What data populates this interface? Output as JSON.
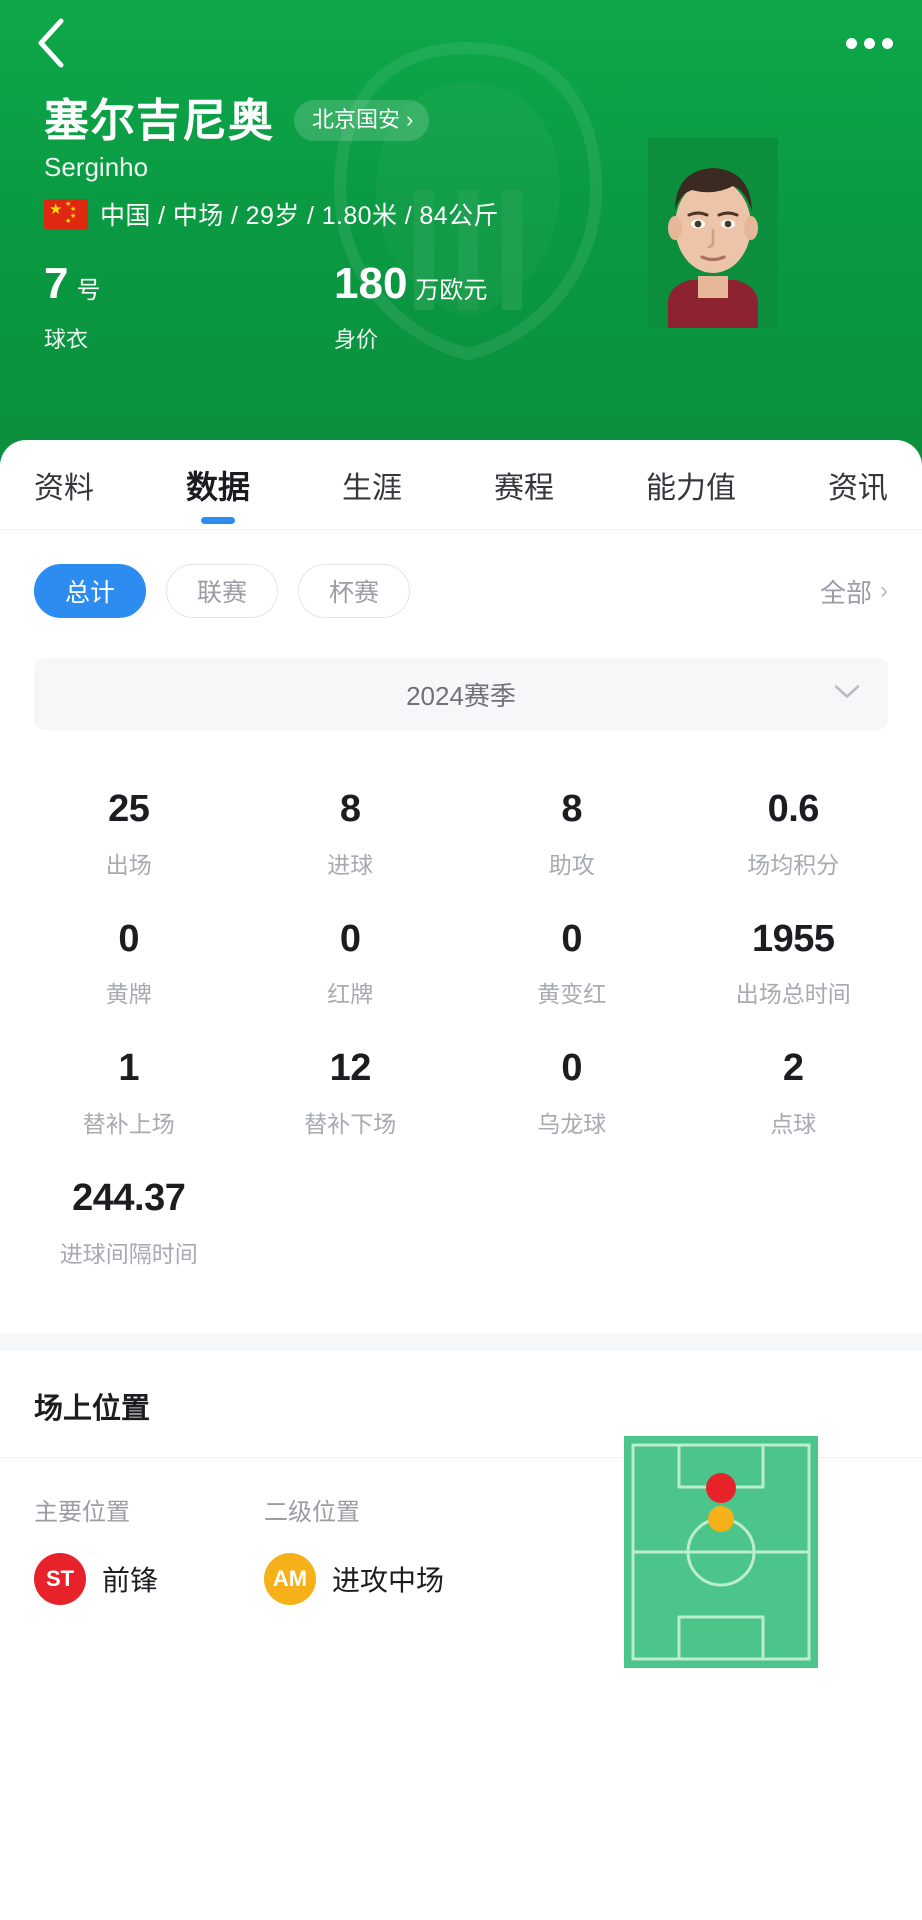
{
  "header": {
    "back_icon": "chevron-left-icon",
    "more_icon": "more-options-icon",
    "player_name": "塞尔吉尼奥",
    "player_alias": "Serginho",
    "team_label": "北京国安",
    "team_chevron": "›",
    "nationality": "中国",
    "meta_text": "中国 / 中场 / 29岁 / 1.80米 / 84公斤",
    "kpis": [
      {
        "value": "7",
        "unit": "号",
        "label": "球衣"
      },
      {
        "value": "180",
        "unit": "万欧元",
        "label": "身价"
      }
    ]
  },
  "tabs": [
    {
      "label": "资料",
      "active": false
    },
    {
      "label": "数据",
      "active": true
    },
    {
      "label": "生涯",
      "active": false
    },
    {
      "label": "赛程",
      "active": false
    },
    {
      "label": "能力值",
      "active": false
    },
    {
      "label": "资讯",
      "active": false
    }
  ],
  "filters": {
    "pills": [
      {
        "label": "总计",
        "active": true
      },
      {
        "label": "联赛",
        "active": false
      },
      {
        "label": "杯赛",
        "active": false
      }
    ],
    "all_label": "全部",
    "all_chevron": "›"
  },
  "season": {
    "label": "2024赛季",
    "caret_icon": "chevron-down-icon"
  },
  "stats": [
    {
      "value": "25",
      "label": "出场"
    },
    {
      "value": "8",
      "label": "进球"
    },
    {
      "value": "8",
      "label": "助攻"
    },
    {
      "value": "0.6",
      "label": "场均积分"
    },
    {
      "value": "0",
      "label": "黄牌"
    },
    {
      "value": "0",
      "label": "红牌"
    },
    {
      "value": "0",
      "label": "黄变红"
    },
    {
      "value": "1955",
      "label": "出场总时间"
    },
    {
      "value": "1",
      "label": "替补上场"
    },
    {
      "value": "12",
      "label": "替补下场"
    },
    {
      "value": "0",
      "label": "乌龙球"
    },
    {
      "value": "2",
      "label": "点球"
    },
    {
      "value": "244.37",
      "label": "进球间隔时间"
    }
  ],
  "position_section": {
    "title": "场上位置",
    "primary": {
      "heading": "主要位置",
      "badge": "ST",
      "name": "前锋",
      "color": "#e8222a"
    },
    "secondary": {
      "heading": "二级位置",
      "badge": "AM",
      "name": "进攻中场",
      "color": "#f5b01a"
    },
    "pitch": {
      "field_color": "#4cc58a",
      "line_color": "#bdeccf",
      "primary_dot_color": "#e8222a",
      "secondary_dot_color": "#f5b01a"
    }
  },
  "colors": {
    "brand_green": "#0a9a42",
    "accent_blue": "#2d8cf0",
    "muted_text": "#a7aab1"
  }
}
